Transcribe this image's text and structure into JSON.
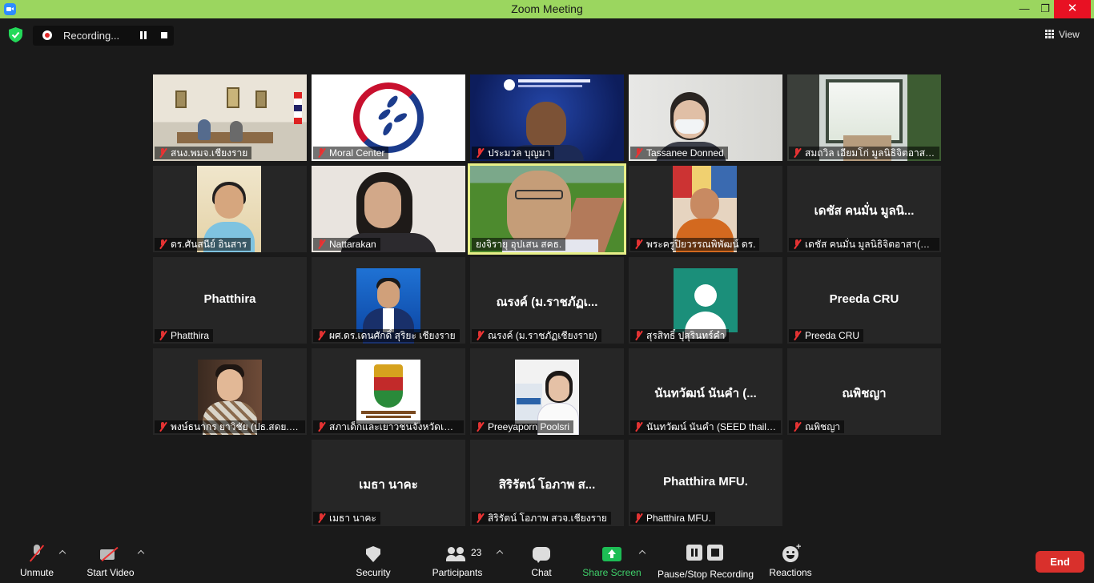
{
  "window": {
    "title": "Zoom Meeting",
    "minimize_glyph": "—",
    "maximize_glyph": "❐",
    "close_glyph": "✕"
  },
  "topbar": {
    "recording_label": "Recording...",
    "view_label": "View"
  },
  "tiles": [
    {
      "name": "สนง.พมจ.เชียงราย",
      "center": ""
    },
    {
      "name": "Moral Center",
      "center": ""
    },
    {
      "name": "ประมวล บุญมา",
      "center": ""
    },
    {
      "name": "Tassanee Donned",
      "center": ""
    },
    {
      "name": "สมถวิล เอียมโก่ มูลนิธิจิตอาสา เ...",
      "center": ""
    },
    {
      "name": "ดร.ศันสนีย์ อินสาร",
      "center": ""
    },
    {
      "name": "Nattarakan",
      "center": ""
    },
    {
      "name": "ยงจิรายุ อุปเสน สคธ.",
      "center": ""
    },
    {
      "name": "พระครูปิยวรรณพิพัฒน์ ดร.",
      "center": ""
    },
    {
      "name": "เดชัส คนมั่น มูลนิธิจิตอาสา(มนส.)",
      "center": "เดชัส คนมั่น มูลนิ..."
    },
    {
      "name": "Phatthira",
      "center": "Phatthira"
    },
    {
      "name": "ผศ.ดร.เดนศักดิ์ สุริยะ เชียงราย",
      "center": ""
    },
    {
      "name": "ณรงค์ (ม.ราชภัฏเชียงราย)",
      "center": "ณรงค์ (ม.ราชภัฏเ..."
    },
    {
      "name": "สุรสิทธิ์ ปุสุรินทร์คำ",
      "center": ""
    },
    {
      "name": "Preeda CRU",
      "center": "Preeda CRU"
    },
    {
      "name": "พงษ์ธนากร ยาวิชัย (ปธ.สดย.ชร)",
      "center": ""
    },
    {
      "name": "สภาเด็กและเยาวชนจังหวัดเชียงร...",
      "center": ""
    },
    {
      "name": "Preeyaporn Poolsri",
      "center": ""
    },
    {
      "name": "นันทวัฒน์ นันคำ (SEED thaila...",
      "center": "นันทวัฒน์ นันคำ (..."
    },
    {
      "name": "ณพิชญา",
      "center": "ณพิชญา"
    },
    {
      "name": "เมธา นาคะ",
      "center": "เมธา นาคะ"
    },
    {
      "name": "สิริรัตน์ โอภาพ สวจ.เชียงราย",
      "center": "สิริรัตน์ โอภาพ ส..."
    },
    {
      "name": "Phatthira MFU.",
      "center": "Phatthira MFU."
    }
  ],
  "toolbar": {
    "unmute": "Unmute",
    "start_video": "Start Video",
    "security": "Security",
    "participants": "Participants",
    "participants_count": "23",
    "chat": "Chat",
    "share_screen": "Share Screen",
    "pause_stop_recording": "Pause/Stop Recording",
    "reactions": "Reactions",
    "end": "End"
  },
  "colors": {
    "titlebar": "#9bd65f",
    "active_speaker_border": "#e8ef88",
    "share_green": "#1dbd55",
    "end_red": "#d9302c"
  }
}
